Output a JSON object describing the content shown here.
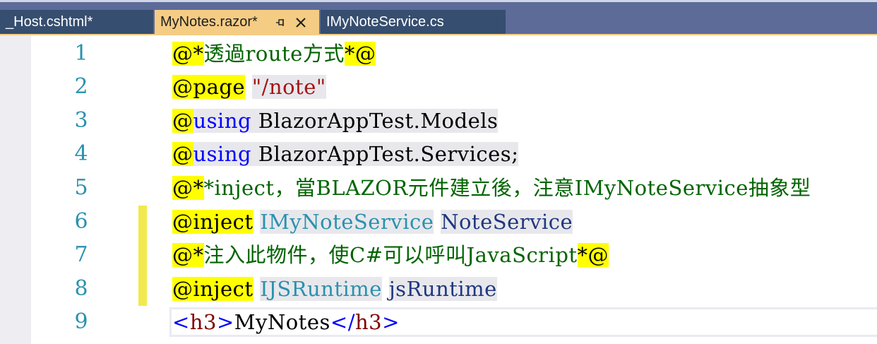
{
  "tabs": [
    {
      "label": "_Host.cshtml*",
      "active": false
    },
    {
      "label": "MyNotes.razor*",
      "active": true,
      "pin_icon": "pin-icon",
      "close_icon": "close-icon"
    },
    {
      "label": "IMyNoteService.cs",
      "active": false
    }
  ],
  "colors": {
    "tab_bar_bg": "#5d6b99",
    "active_tab_bg": "#f5cc84",
    "inactive_tab_bg": "#364e6f",
    "line_number": "#2b91af",
    "razor_marker_bg": "#ffff00",
    "comment": "#006400",
    "keyword": "#0000ff",
    "string": "#a31515",
    "type": "#2b91af",
    "change_marker": "#f2e94e"
  },
  "editor": {
    "line_numbers": [
      "1",
      "2",
      "3",
      "4",
      "5",
      "6",
      "7",
      "8",
      "9"
    ],
    "lines": [
      {
        "number": "1",
        "segments": [
          {
            "text": "@*",
            "kind": "at"
          },
          {
            "text": "透過route方式",
            "kind": "cm"
          },
          {
            "text": "*@",
            "kind": "at"
          }
        ]
      },
      {
        "number": "2",
        "segments": [
          {
            "text": "@page",
            "kind": "at"
          },
          {
            "text": " ",
            "kind": "plain"
          },
          {
            "text": "\"/note\"",
            "kind": "str-hl"
          }
        ]
      },
      {
        "number": "3",
        "segments": [
          {
            "text": "@",
            "kind": "at"
          },
          {
            "text": "using",
            "kind": "kw-hl"
          },
          {
            "text": " BlazorAppTest.Models",
            "kind": "plain-hl"
          }
        ]
      },
      {
        "number": "4",
        "segments": [
          {
            "text": "@",
            "kind": "at"
          },
          {
            "text": "using",
            "kind": "kw-hl"
          },
          {
            "text": " BlazorAppTest.Services;",
            "kind": "plain-hl"
          }
        ]
      },
      {
        "number": "5",
        "segments": [
          {
            "text": "@*",
            "kind": "at"
          },
          {
            "text": "*inject，當BLAZOR元件建立後，注意IMyNoteService抽象型",
            "kind": "cm"
          }
        ]
      },
      {
        "number": "6",
        "segments": [
          {
            "text": "@inject",
            "kind": "at"
          },
          {
            "text": " ",
            "kind": "plain"
          },
          {
            "text": "IMyNoteService",
            "kind": "typ-hl"
          },
          {
            "text": " ",
            "kind": "plain"
          },
          {
            "text": "NoteService",
            "kind": "idt-hl"
          }
        ]
      },
      {
        "number": "7",
        "segments": [
          {
            "text": "@*",
            "kind": "at"
          },
          {
            "text": "注入此物件，使C#可以呼叫JavaScript",
            "kind": "cm"
          },
          {
            "text": "*@",
            "kind": "at"
          }
        ]
      },
      {
        "number": "8",
        "segments": [
          {
            "text": "@inject",
            "kind": "at"
          },
          {
            "text": " ",
            "kind": "plain"
          },
          {
            "text": "IJSRuntime",
            "kind": "typ-hl"
          },
          {
            "text": " ",
            "kind": "plain"
          },
          {
            "text": "jsRuntime",
            "kind": "idt-hl"
          }
        ]
      },
      {
        "number": "9",
        "segments": [
          {
            "text": "<",
            "kind": "ang"
          },
          {
            "text": "h3",
            "kind": "tag"
          },
          {
            "text": ">",
            "kind": "ang"
          },
          {
            "text": "MyNotes",
            "kind": "plain"
          },
          {
            "text": "</",
            "kind": "ang"
          },
          {
            "text": "h3",
            "kind": "tag"
          },
          {
            "text": ">",
            "kind": "ang"
          }
        ]
      }
    ],
    "changed_lines": [
      "6",
      "7",
      "8"
    ],
    "current_line": "9"
  }
}
